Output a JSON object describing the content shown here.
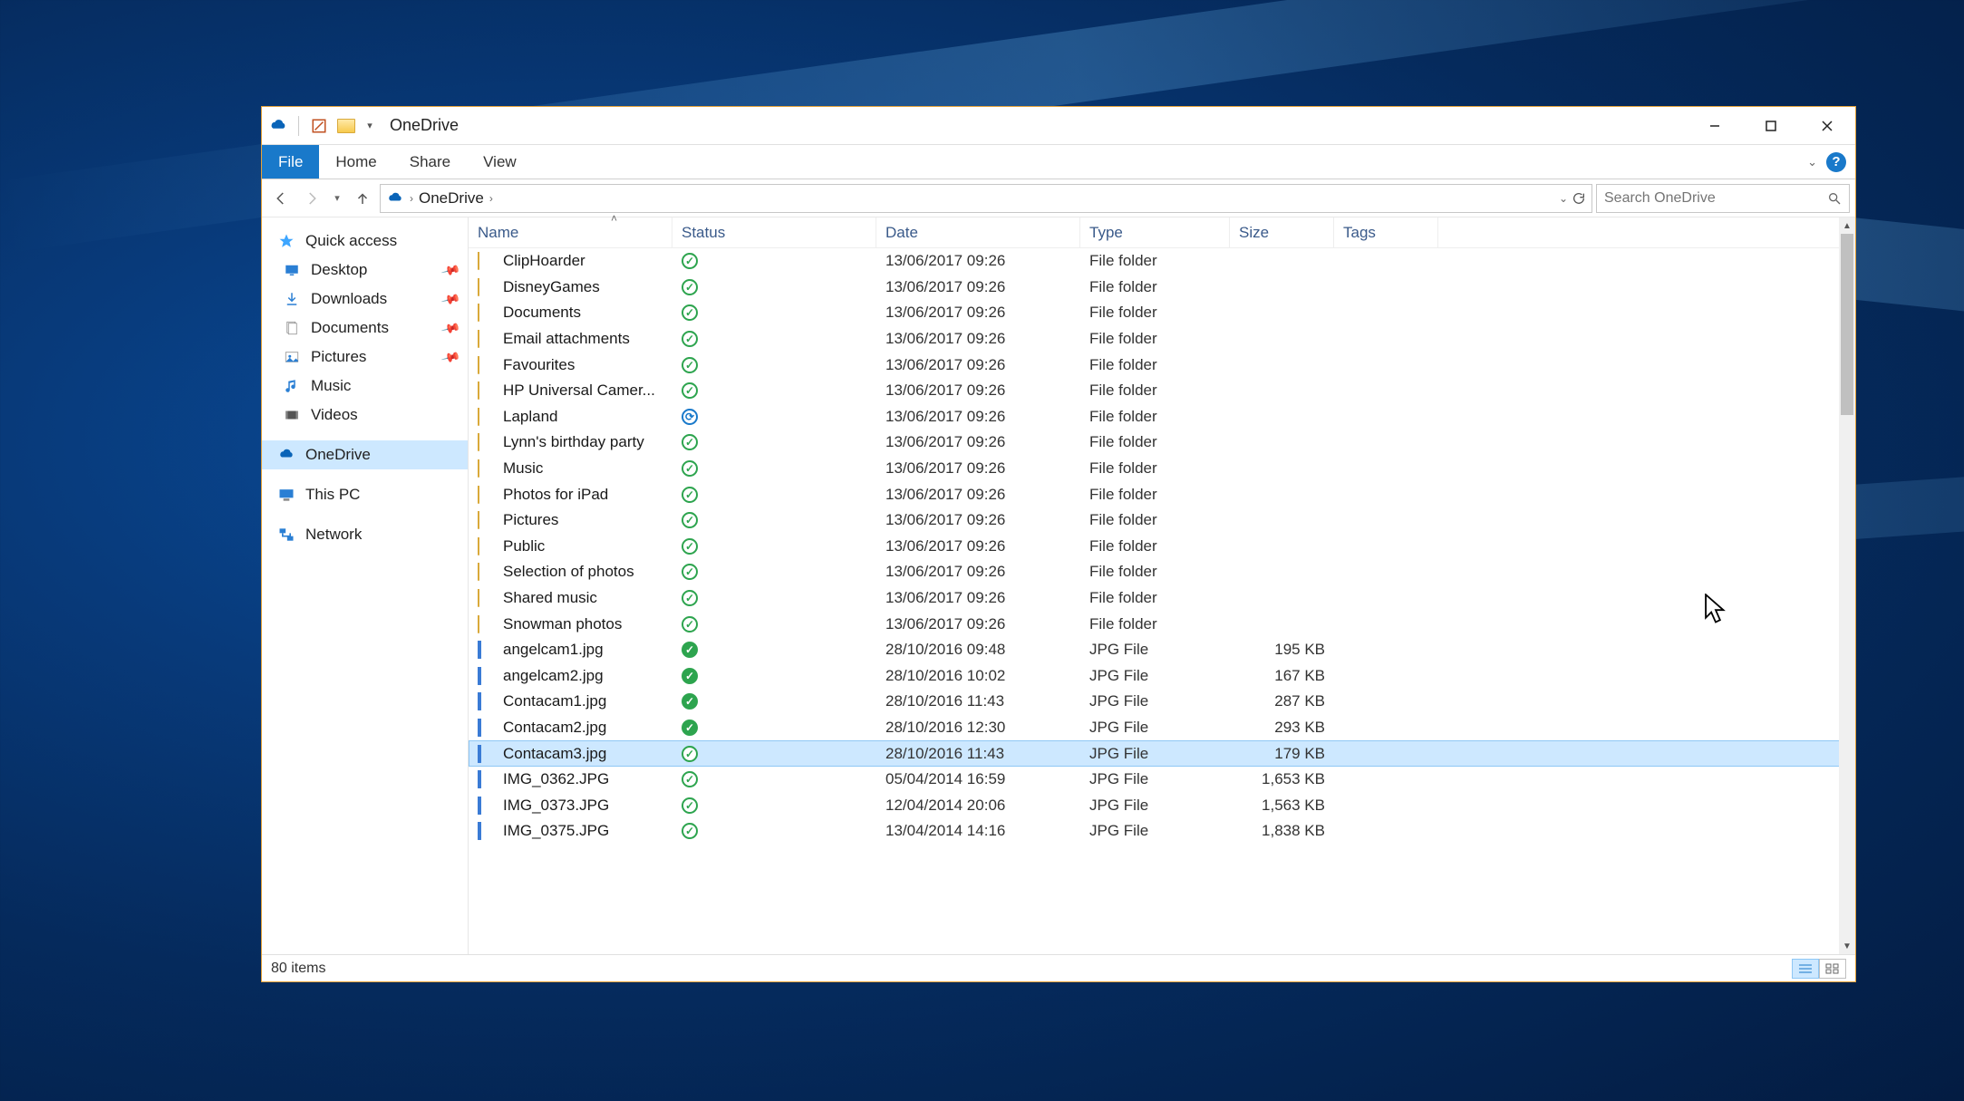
{
  "window": {
    "title": "OneDrive",
    "tabs": {
      "file": "File",
      "home": "Home",
      "share": "Share",
      "view": "View"
    }
  },
  "address": {
    "location": "OneDrive",
    "search_placeholder": "Search OneDrive"
  },
  "sidebar": {
    "quick_access": "Quick access",
    "desktop": "Desktop",
    "downloads": "Downloads",
    "documents": "Documents",
    "pictures": "Pictures",
    "music": "Music",
    "videos": "Videos",
    "onedrive": "OneDrive",
    "this_pc": "This PC",
    "network": "Network"
  },
  "columns": {
    "name": "Name",
    "status": "Status",
    "date": "Date",
    "type": "Type",
    "size": "Size",
    "tags": "Tags"
  },
  "rows": [
    {
      "icon": "folder",
      "name": "ClipHoarder",
      "status": "online",
      "date": "13/06/2017 09:26",
      "type": "File folder",
      "size": ""
    },
    {
      "icon": "folder",
      "name": "DisneyGames",
      "status": "online",
      "date": "13/06/2017 09:26",
      "type": "File folder",
      "size": ""
    },
    {
      "icon": "folder",
      "name": "Documents",
      "status": "online",
      "date": "13/06/2017 09:26",
      "type": "File folder",
      "size": ""
    },
    {
      "icon": "folder",
      "name": "Email attachments",
      "status": "online",
      "date": "13/06/2017 09:26",
      "type": "File folder",
      "size": ""
    },
    {
      "icon": "folder",
      "name": "Favourites",
      "status": "online",
      "date": "13/06/2017 09:26",
      "type": "File folder",
      "size": ""
    },
    {
      "icon": "folder",
      "name": "HP Universal Camer...",
      "status": "online",
      "date": "13/06/2017 09:26",
      "type": "File folder",
      "size": ""
    },
    {
      "icon": "folder",
      "name": "Lapland",
      "status": "sync",
      "date": "13/06/2017 09:26",
      "type": "File folder",
      "size": ""
    },
    {
      "icon": "folder",
      "name": "Lynn's birthday party",
      "status": "online",
      "date": "13/06/2017 09:26",
      "type": "File folder",
      "size": ""
    },
    {
      "icon": "folder",
      "name": "Music",
      "status": "online",
      "date": "13/06/2017 09:26",
      "type": "File folder",
      "size": ""
    },
    {
      "icon": "folder",
      "name": "Photos for iPad",
      "status": "online",
      "date": "13/06/2017 09:26",
      "type": "File folder",
      "size": ""
    },
    {
      "icon": "folder",
      "name": "Pictures",
      "status": "online",
      "date": "13/06/2017 09:26",
      "type": "File folder",
      "size": ""
    },
    {
      "icon": "folder",
      "name": "Public",
      "status": "online",
      "date": "13/06/2017 09:26",
      "type": "File folder",
      "size": ""
    },
    {
      "icon": "folder",
      "name": "Selection of photos",
      "status": "online",
      "date": "13/06/2017 09:26",
      "type": "File folder",
      "size": ""
    },
    {
      "icon": "folder",
      "name": "Shared music",
      "status": "online",
      "date": "13/06/2017 09:26",
      "type": "File folder",
      "size": ""
    },
    {
      "icon": "folder",
      "name": "Snowman photos",
      "status": "online",
      "date": "13/06/2017 09:26",
      "type": "File folder",
      "size": ""
    },
    {
      "icon": "image",
      "name": "angelcam1.jpg",
      "status": "local",
      "date": "28/10/2016 09:48",
      "type": "JPG File",
      "size": "195 KB"
    },
    {
      "icon": "image",
      "name": "angelcam2.jpg",
      "status": "local",
      "date": "28/10/2016 10:02",
      "type": "JPG File",
      "size": "167 KB"
    },
    {
      "icon": "image",
      "name": "Contacam1.jpg",
      "status": "local",
      "date": "28/10/2016 11:43",
      "type": "JPG File",
      "size": "287 KB"
    },
    {
      "icon": "image",
      "name": "Contacam2.jpg",
      "status": "local",
      "date": "28/10/2016 12:30",
      "type": "JPG File",
      "size": "293 KB"
    },
    {
      "icon": "image",
      "name": "Contacam3.jpg",
      "status": "online",
      "date": "28/10/2016 11:43",
      "type": "JPG File",
      "size": "179 KB",
      "selected": true
    },
    {
      "icon": "image",
      "name": "IMG_0362.JPG",
      "status": "online",
      "date": "05/04/2014 16:59",
      "type": "JPG File",
      "size": "1,653 KB"
    },
    {
      "icon": "image",
      "name": "IMG_0373.JPG",
      "status": "online",
      "date": "12/04/2014 20:06",
      "type": "JPG File",
      "size": "1,563 KB"
    },
    {
      "icon": "image",
      "name": "IMG_0375.JPG",
      "status": "online",
      "date": "13/04/2014 14:16",
      "type": "JPG File",
      "size": "1,838 KB"
    }
  ],
  "statusbar": {
    "count": "80 items"
  }
}
